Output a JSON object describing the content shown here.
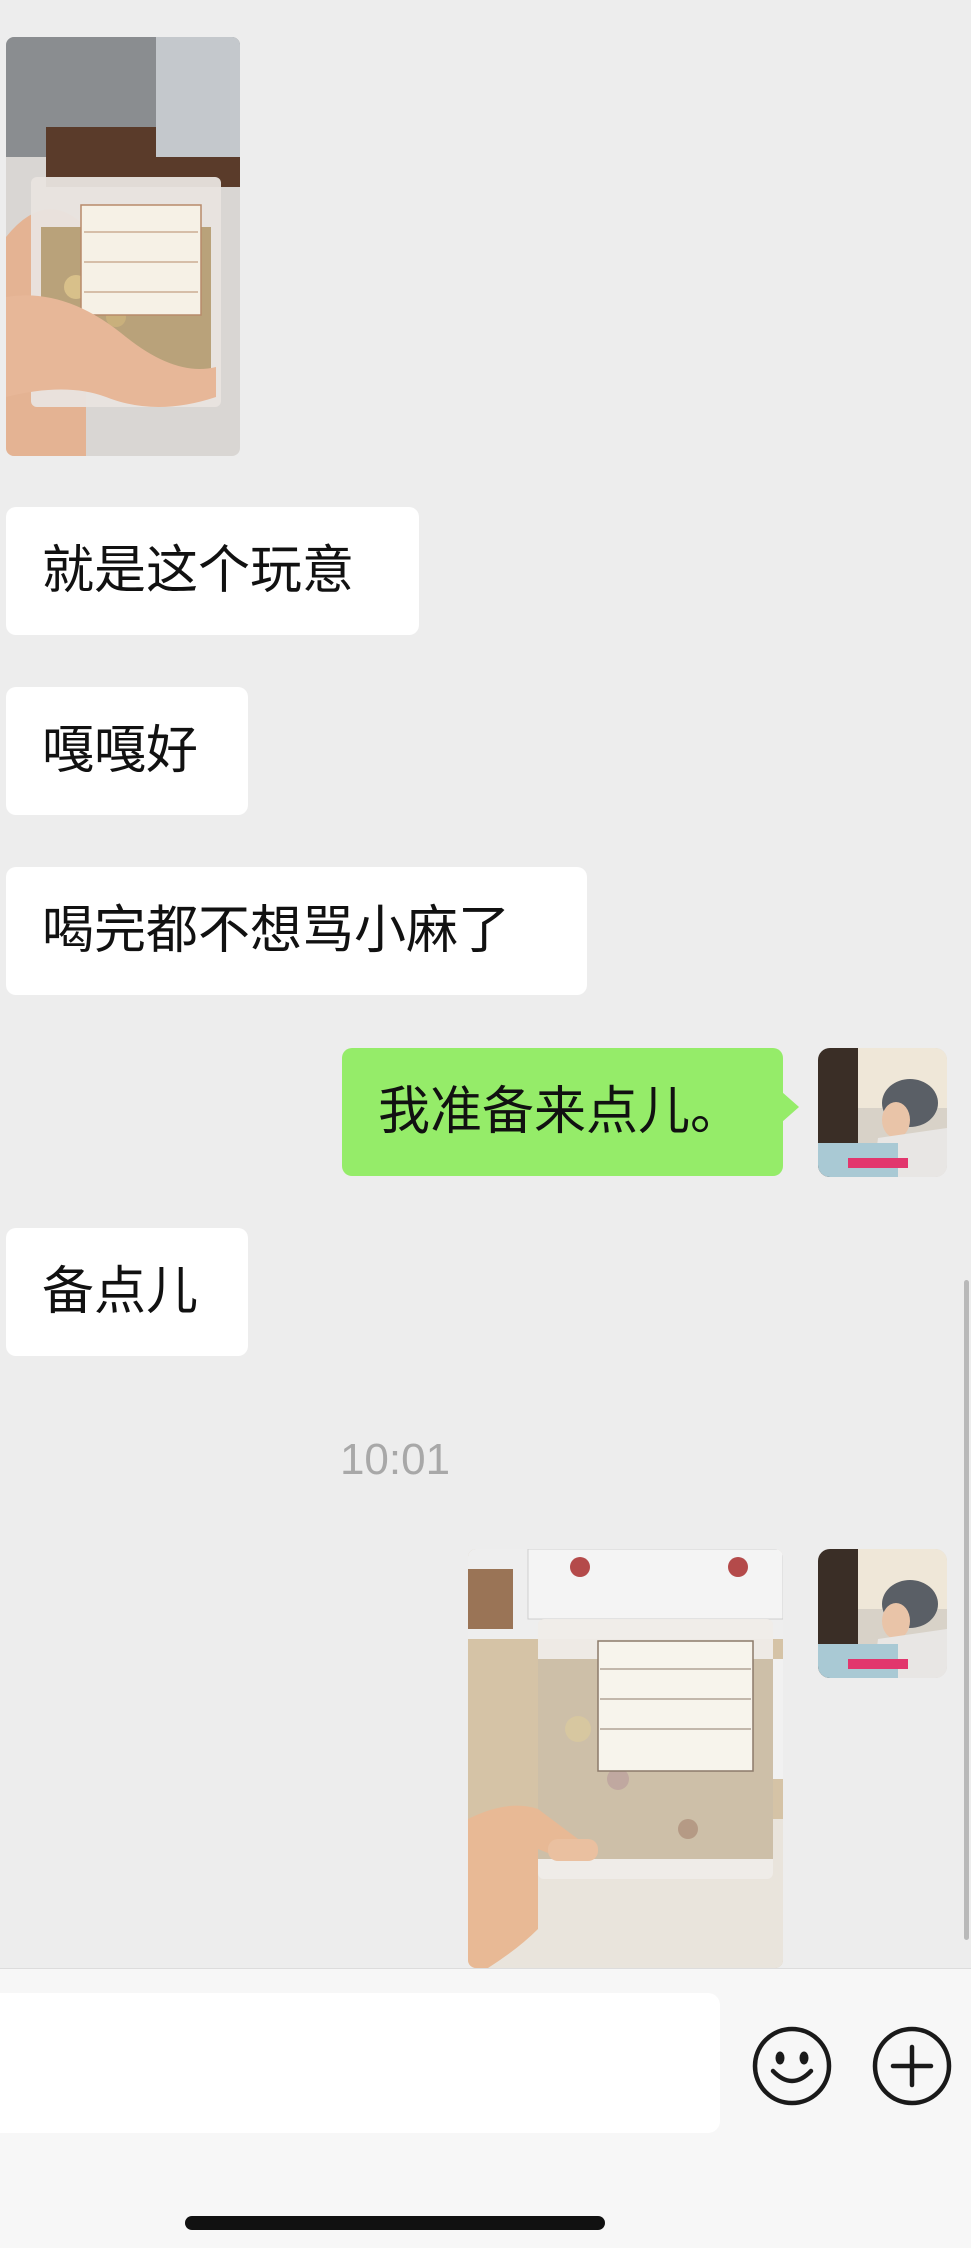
{
  "messages": [
    {
      "side": "in",
      "type": "image",
      "description": "photo of herbal tea pack"
    },
    {
      "side": "in",
      "type": "text",
      "text": "就是这个玩意"
    },
    {
      "side": "in",
      "type": "text",
      "text": "嘎嘎好"
    },
    {
      "side": "in",
      "type": "text",
      "text": "喝完都不想骂小麻了"
    },
    {
      "side": "out",
      "type": "text",
      "text": "我准备来点儿。"
    },
    {
      "side": "in",
      "type": "text",
      "text": "备点儿"
    },
    {
      "side": "out",
      "type": "image",
      "description": "photo of herbal tea pack"
    }
  ],
  "timestamp": "10:01",
  "input": {
    "placeholder": ""
  },
  "icons": {
    "emoji": "emoji-icon",
    "more": "plus-circle-icon"
  },
  "colors": {
    "background": "#ededed",
    "bubble_out": "#95ec69",
    "bubble_in": "#ffffff"
  }
}
